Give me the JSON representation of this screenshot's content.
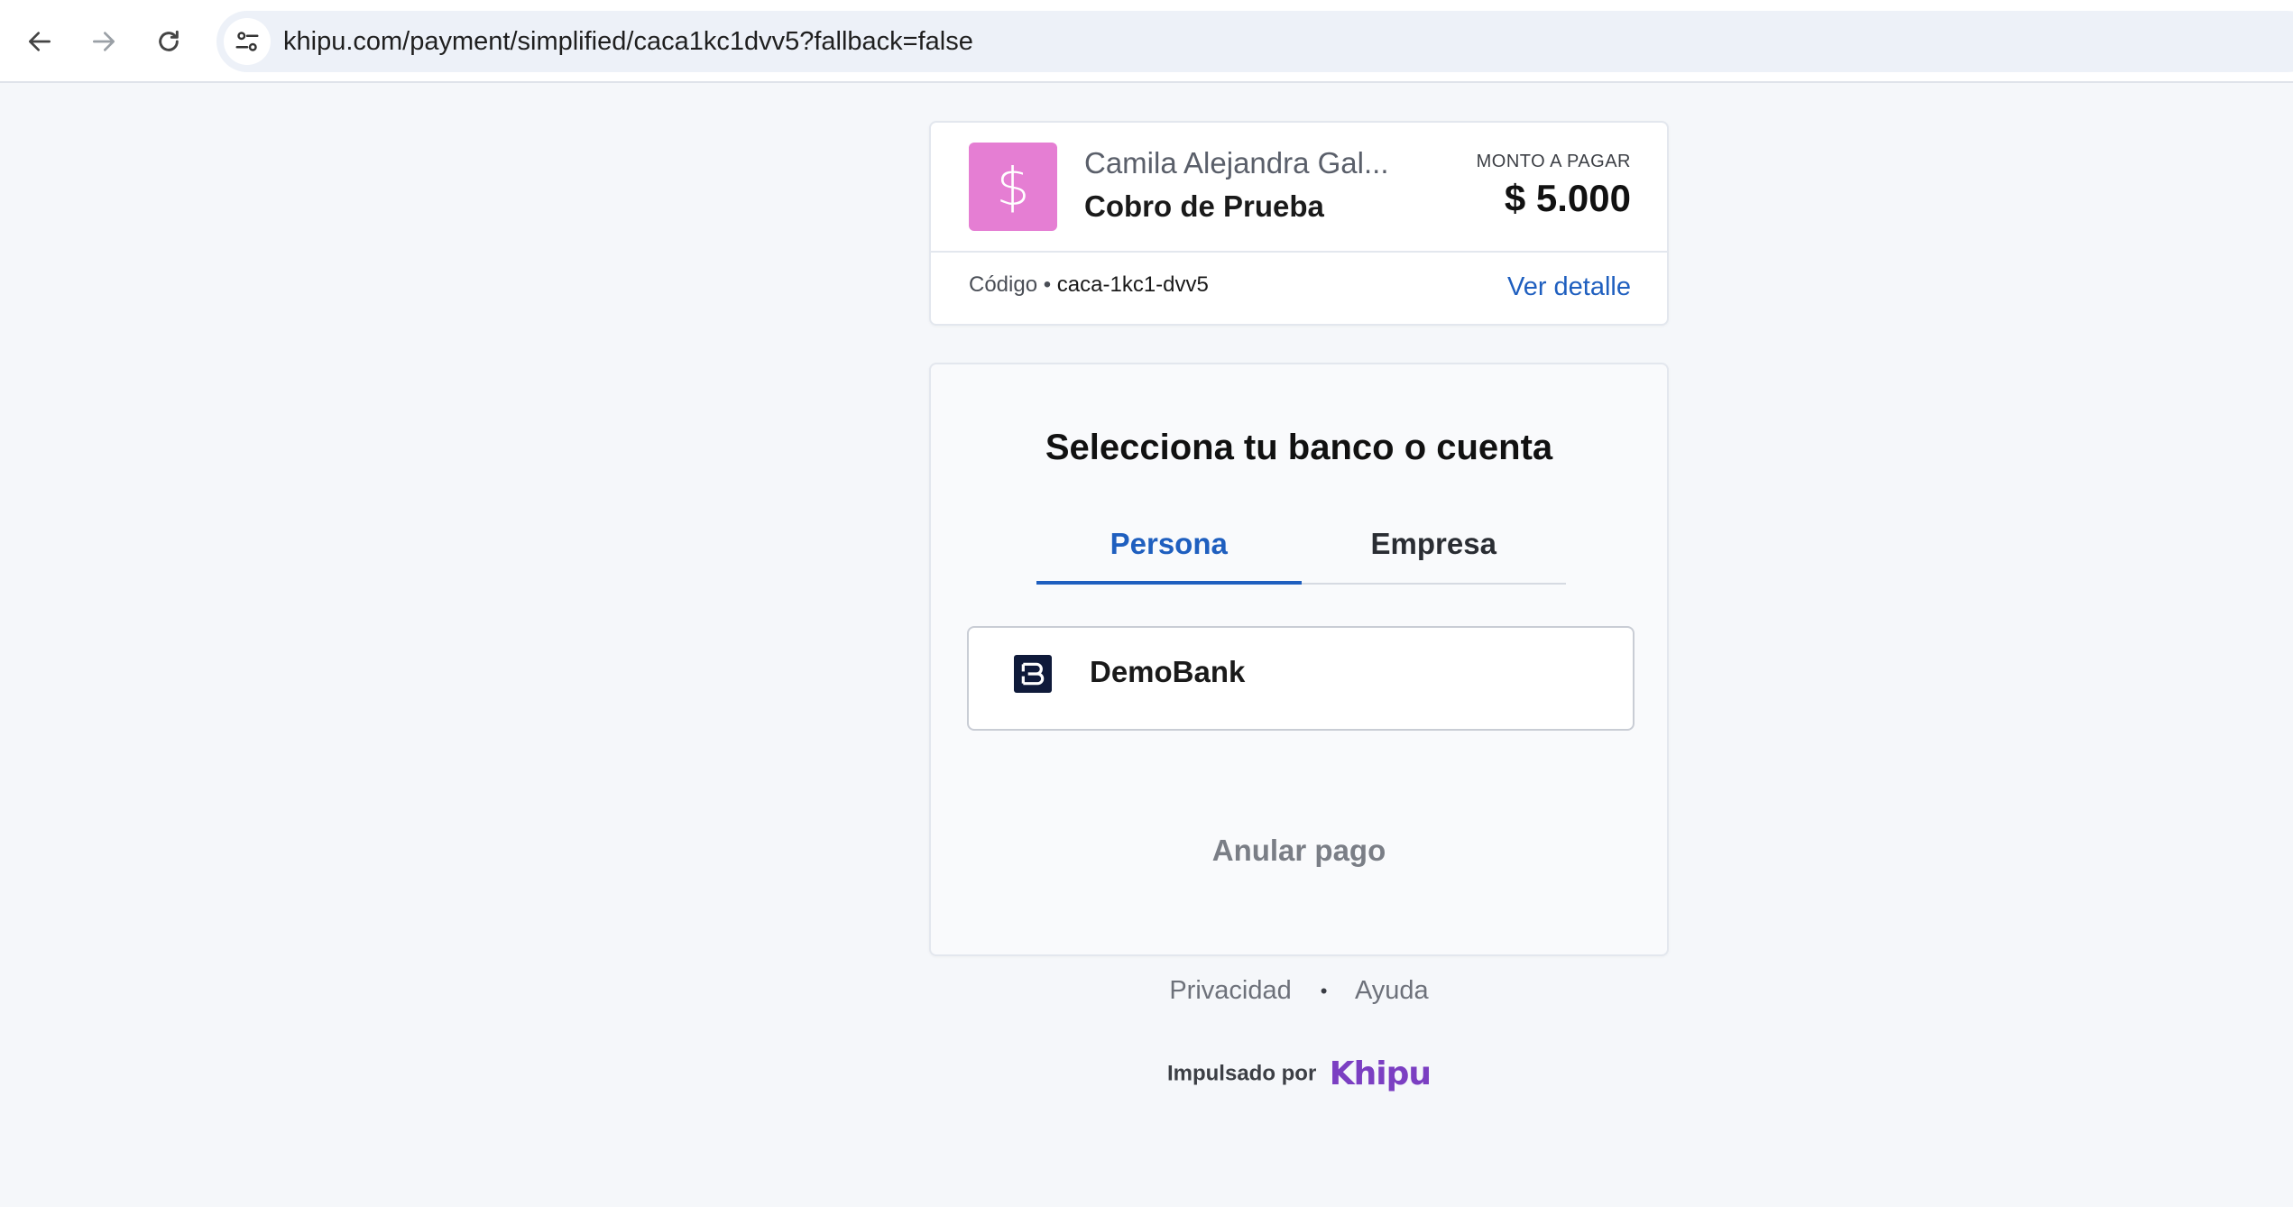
{
  "browser": {
    "url": "khipu.com/payment/simplified/caca1kc1dvv5?fallback=false",
    "icons": {
      "back": "arrow-left-icon",
      "forward": "arrow-right-icon",
      "reload": "reload-icon",
      "site_info": "tune-icon"
    }
  },
  "payment": {
    "merchant_name": "Camila Alejandra Gal...",
    "subject": "Cobro de Prueba",
    "amount_label": "MONTO A PAGAR",
    "amount": "$ 5.000",
    "logo_symbol": "$",
    "logo_color": "#e57ed3",
    "code_label": "Código •",
    "code_value": "caca-1kc1-dvv5",
    "view_detail": "Ver detalle"
  },
  "bank_selection": {
    "title": "Selecciona tu banco o cuenta",
    "tabs": [
      {
        "label": "Persona",
        "active": true
      },
      {
        "label": "Empresa",
        "active": false
      }
    ],
    "banks": [
      {
        "name": "DemoBank",
        "icon": "demobank-logo-icon"
      }
    ],
    "cancel_label": "Anular pago"
  },
  "footer": {
    "privacy": "Privacidad",
    "separator": "•",
    "help": "Ayuda",
    "powered_by": "Impulsado por",
    "brand": "Khipu"
  },
  "colors": {
    "accent": "#1f5fbf",
    "brand": "#7b3fc2",
    "background": "#f5f7fa"
  }
}
